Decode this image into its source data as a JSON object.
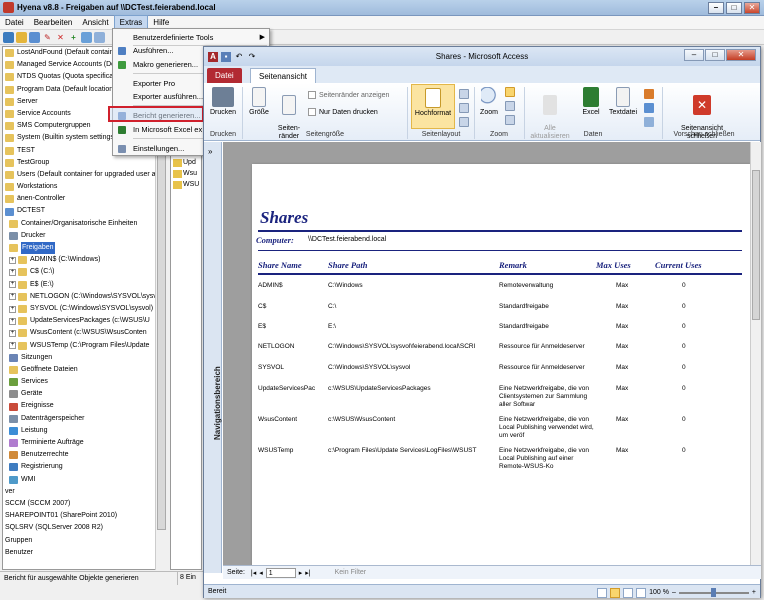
{
  "hyena": {
    "title": "Hyena v8.8 - Freigaben auf \\\\DCTest.feierabend.local",
    "menu": [
      "Datei",
      "Bearbeiten",
      "Ansicht",
      "Extras",
      "Hilfe"
    ],
    "tree": [
      {
        "label": "LostAndFound (Default containe",
        "indent": 0,
        "icon": "container-icon"
      },
      {
        "label": "Managed Service Accounts (Def",
        "indent": 0,
        "icon": "container-icon"
      },
      {
        "label": "NTDS Quotas (Quota specificatio",
        "indent": 0,
        "icon": "container-icon"
      },
      {
        "label": "Program Data (Default location f",
        "indent": 0,
        "icon": "container-icon"
      },
      {
        "label": "Server",
        "indent": 0,
        "icon": "container-icon"
      },
      {
        "label": "Service Accounts",
        "indent": 0,
        "icon": "container-icon"
      },
      {
        "label": "SMS Computergruppen",
        "indent": 0,
        "icon": "container-icon"
      },
      {
        "label": "System (Builtin system settings)",
        "indent": 0,
        "icon": "container-icon"
      },
      {
        "label": "TEST",
        "indent": 0,
        "icon": "container-icon"
      },
      {
        "label": "TestGroup",
        "indent": 0,
        "icon": "container-icon"
      },
      {
        "label": "Users (Default container for upgraded user a",
        "indent": 0,
        "icon": "container-icon"
      },
      {
        "label": "Workstations",
        "indent": 0,
        "icon": "container-icon"
      },
      {
        "label": "änen-Controller",
        "indent": 0,
        "icon": "container-icon"
      },
      {
        "label": "DCTEST",
        "indent": 0,
        "icon": "computer-icon"
      },
      {
        "label": "Container/Organisatorische Einheiten",
        "indent": 1,
        "icon": "folder-icon"
      },
      {
        "label": "Drucker",
        "indent": 1,
        "icon": "printer-icon"
      },
      {
        "label": "Freigaben",
        "indent": 1,
        "icon": "share-icon",
        "selected": true
      },
      {
        "label": "ADMIN$ (C:\\Windows)",
        "indent": 1,
        "icon": "share-folder-icon",
        "expander": "+"
      },
      {
        "label": "C$ (C:\\)",
        "indent": 1,
        "icon": "share-folder-icon",
        "expander": "+"
      },
      {
        "label": "E$ (E:\\)",
        "indent": 1,
        "icon": "share-folder-icon",
        "expander": "+"
      },
      {
        "label": "NETLOGON (C:\\Windows\\SYSVOL\\sysv",
        "indent": 1,
        "icon": "share-folder-icon",
        "expander": "+"
      },
      {
        "label": "SYSVOL (C:\\Windows\\SYSVOL\\sysvol)",
        "indent": 1,
        "icon": "share-folder-icon",
        "expander": "+"
      },
      {
        "label": "UpdateServicesPackages (c:\\WSUS\\U",
        "indent": 1,
        "icon": "share-folder-icon",
        "expander": "+"
      },
      {
        "label": "WsusContent (c:\\WSUS\\WsusConten",
        "indent": 1,
        "icon": "share-folder-icon",
        "expander": "+"
      },
      {
        "label": "WSUSTemp (C:\\Program Files\\Update",
        "indent": 1,
        "icon": "share-folder-icon",
        "expander": "+"
      },
      {
        "label": "Sitzungen",
        "indent": 1,
        "icon": "sessions-icon"
      },
      {
        "label": "Geöffnete Dateien",
        "indent": 1,
        "icon": "open-files-icon"
      },
      {
        "label": "Services",
        "indent": 1,
        "icon": "services-icon"
      },
      {
        "label": "Geräte",
        "indent": 1,
        "icon": "devices-icon"
      },
      {
        "label": "Ereignisse",
        "indent": 1,
        "icon": "events-icon"
      },
      {
        "label": "Datenträgerspeicher",
        "indent": 1,
        "icon": "disk-icon"
      },
      {
        "label": "Leistung",
        "indent": 1,
        "icon": "performance-icon"
      },
      {
        "label": "Terminierte Aufträge",
        "indent": 1,
        "icon": "scheduled-jobs-icon"
      },
      {
        "label": "Benutzerrechte",
        "indent": 1,
        "icon": "user-rights-icon"
      },
      {
        "label": "Registrierung",
        "indent": 1,
        "icon": "registry-icon"
      },
      {
        "label": "WMI",
        "indent": 1,
        "icon": "wmi-icon"
      },
      {
        "label": "ver",
        "indent": 0,
        "icon": ""
      },
      {
        "label": "SCCM (SCCM 2007)",
        "indent": 0,
        "icon": ""
      },
      {
        "label": "SHAREPOINT01 (SharePoint 2010)",
        "indent": 0,
        "icon": ""
      },
      {
        "label": "SQLSRV (SQLServer 2008 R2)",
        "indent": 0,
        "icon": ""
      },
      {
        "label": "Gruppen",
        "indent": 0,
        "icon": ""
      },
      {
        "label": "Benutzer",
        "indent": 0,
        "icon": ""
      }
    ],
    "right_list": [
      "Upd",
      "Wsu",
      "WSU"
    ],
    "status": "Bericht für ausgewählte Objekte generieren",
    "status_count": "8 Ein"
  },
  "extras_menu": {
    "items": [
      {
        "label": "Benutzerdefinierte Tools",
        "submenu": true,
        "icon": ""
      },
      {
        "label": "Ausführen...",
        "icon": "run-icon"
      },
      {
        "label": "Makro generieren...",
        "icon": "macro-icon"
      },
      {
        "label": "Exporter Pro",
        "icon": ""
      },
      {
        "label": "Exporter ausführen...",
        "icon": ""
      },
      {
        "label": "Bericht generieren...",
        "icon": "report-icon",
        "highlighted": true
      },
      {
        "label": "In Microsoft Excel ex",
        "icon": "excel-icon"
      },
      {
        "label": "Einstellungen...",
        "icon": "settings-icon"
      }
    ]
  },
  "access": {
    "title": "Shares - Microsoft Access",
    "tabs": {
      "file": "Datei",
      "page_view": "Seitenansicht"
    },
    "ribbon": {
      "drucken": "Drucken",
      "groesse": "Größe",
      "seitenraender": "Seiten-\nränder",
      "chk_margins": "Seitenränder anzeigen",
      "chk_data_only": "Nur Daten drucken",
      "hochformat": "Hochformat",
      "zoom": "Zoom",
      "alle_aktualisieren": "Alle\naktualisieren",
      "excel": "Excel",
      "textdatei": "Textdatei",
      "close_preview": "Seitenansicht\nschließen",
      "groups": {
        "drucken": "Drucken",
        "seitengroesse": "Seitengröße",
        "seitenlayout": "Seitenlayout",
        "zoom": "Zoom",
        "daten": "Daten",
        "vorschau": "Vorschau schließen"
      }
    },
    "nav_label": "Navigationsbereich",
    "report": {
      "title": "Shares",
      "computer_label": "Computer:",
      "computer_value": "\\\\DCTest.feierabend.local",
      "headers": {
        "name": "Share Name",
        "path": "Share Path",
        "remark": "Remark",
        "max": "Max Uses",
        "current": "Current Uses"
      },
      "rows": [
        {
          "name": "ADMIN$",
          "path": "C:\\Windows",
          "remark": "Remoteverwaltung",
          "max": "Max",
          "current": "0"
        },
        {
          "name": "C$",
          "path": "C:\\",
          "remark": "Standardfreigabe",
          "max": "Max",
          "current": "0"
        },
        {
          "name": "E$",
          "path": "E:\\",
          "remark": "Standardfreigabe",
          "max": "Max",
          "current": "0"
        },
        {
          "name": "NETLOGON",
          "path": "C:\\Windows\\SYSVOL\\sysvol\\feierabend.local\\SCRI",
          "remark": "Ressource für Anmeldeserver",
          "max": "Max",
          "current": "0"
        },
        {
          "name": "SYSVOL",
          "path": "C:\\Windows\\SYSVOL\\sysvol",
          "remark": "Ressource für Anmeldeserver",
          "max": "Max",
          "current": "0"
        },
        {
          "name": "UpdateServicesPac",
          "path": "c:\\WSUS\\UpdateServicesPackages",
          "remark": "Eine Netzwerkfreigabe, die von Clientsystemen zur Sammlung aller Softwar",
          "max": "Max",
          "current": "0"
        },
        {
          "name": "WsusContent",
          "path": "c:\\WSUS\\WsusContent",
          "remark": "Eine Netzwerkfreigabe, die von Local Publishing verwendet wird, um veröf",
          "max": "Max",
          "current": "0"
        },
        {
          "name": "WSUSTemp",
          "path": "c:\\Program Files\\Update Services\\LogFiles\\WSUST",
          "remark": "Eine Netzwerkfreigabe, die von Local Publishing auf einer Remote-WSUS-Ko",
          "max": "Max",
          "current": "0"
        }
      ]
    },
    "footer": {
      "page_label": "Seite:",
      "page_value": "1",
      "filter": "Kein Filter"
    },
    "status": "Bereit",
    "zoom": "100 %"
  }
}
